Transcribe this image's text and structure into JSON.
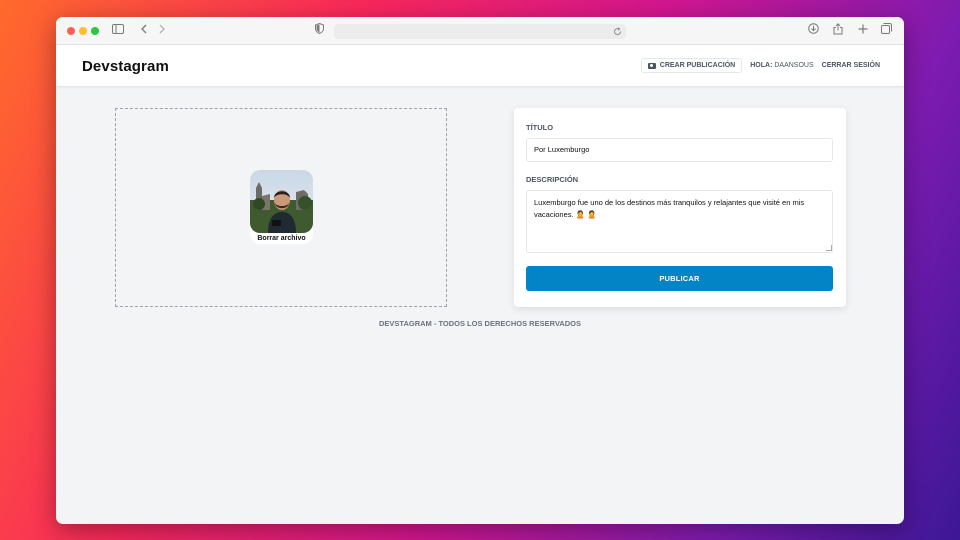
{
  "browser": {
    "icons": [
      "sidebar-icon",
      "back-icon",
      "forward-icon",
      "shield-icon",
      "reload-icon",
      "download-icon",
      "share-icon",
      "new-tab-icon",
      "tabs-icon"
    ]
  },
  "navbar": {
    "brand": "Devstagram",
    "create_post": "Crear Publicación",
    "hello_label": "Hola:",
    "username": "daansous",
    "logout": "Cerrar Sesión"
  },
  "dropzone": {
    "remove_file": "Borrar archivo"
  },
  "form": {
    "title_label": "Título",
    "title_value": "Por Luxemburgo",
    "description_label": "Descripción",
    "description_value": "Luxemburgo fue uno de los destinos más tranquilos y relajantes que visité en mis vacaciones.",
    "description_emojis": "🙎 🙎",
    "submit": "Publicar"
  },
  "footer": {
    "text": "Devstagram - Todos los derechos reservados"
  },
  "colors": {
    "primary": "#0284c7",
    "page_bg": "#f3f4f6"
  }
}
